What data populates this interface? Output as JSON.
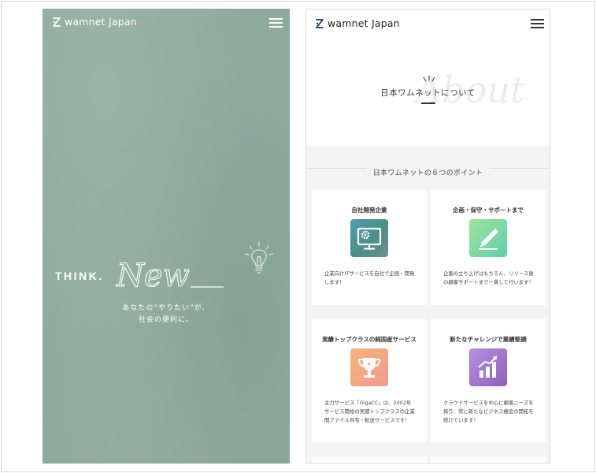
{
  "brand": {
    "name": "wamnet Japan"
  },
  "hero": {
    "think": "THINK.",
    "new_word": "New",
    "tagline_line1": "あなたの“やりたい”が、",
    "tagline_line2": "社会の便利に。"
  },
  "about": {
    "script_word": "About",
    "title": "日本ワムネットについて"
  },
  "points": {
    "title": "日本ワムネットの６つのポイント",
    "cards": [
      {
        "title": "自社開発企業",
        "icon": "computer-gear-icon",
        "desc": "企業向けITサービスを自社で企画・開発します！"
      },
      {
        "title": "企画・保守・サポートまで",
        "icon": "pen-icon",
        "desc": "企画の立ち上げはもちろん、リリース後の顧客サポートまで一貫して行います！"
      },
      {
        "title": "実績トップクラスの純国産サービス",
        "icon": "trophy-icon",
        "desc": "主力サービス「GigaCC」は、2002年サービス開始の実績トップクラスの企業間ファイル共有・転送サービスです！"
      },
      {
        "title": "新たなチャレンジで業績堅調",
        "icon": "growth-chart-icon",
        "desc": "クラウドサービスを中心に顧客ニーズを探り、常に新たなビジネス機会の開拓を続けています！"
      }
    ]
  },
  "colors": {
    "hero_bg": "#8fab9e",
    "section_bg": "#f4f4f4"
  }
}
